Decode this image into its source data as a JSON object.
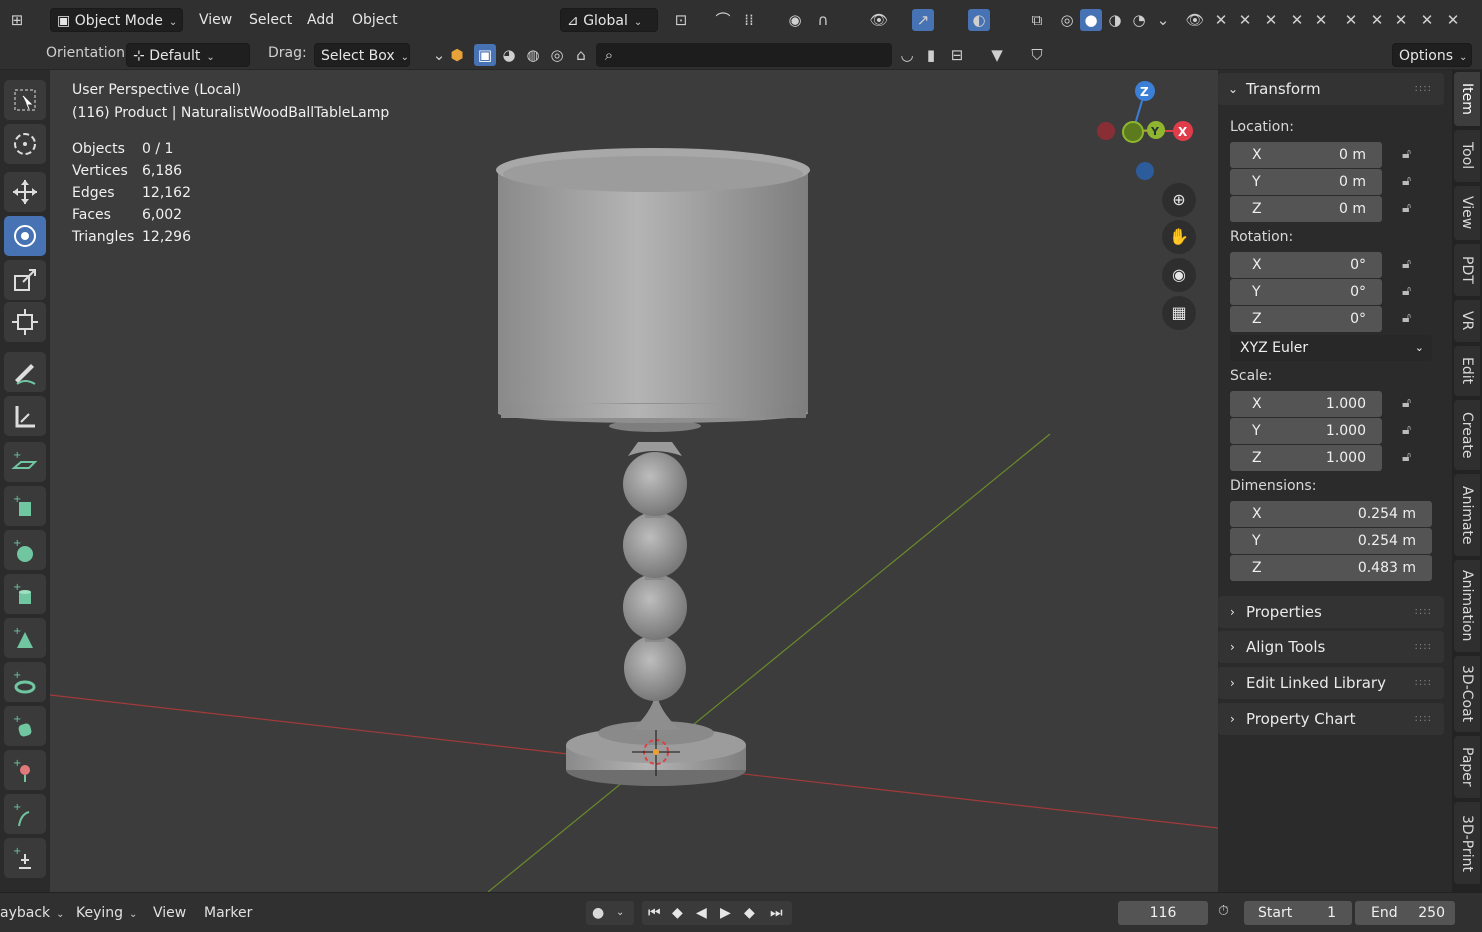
{
  "header": {
    "mode": "Object Mode",
    "menus": [
      "View",
      "Select",
      "Add",
      "Object"
    ],
    "transform_orientation": "Global",
    "orientation_label": "Orientation:",
    "orientation_value": "Default",
    "drag_label": "Drag:",
    "drag_value": "Select Box",
    "options": "Options"
  },
  "viewport": {
    "view_name": "User Perspective (Local)",
    "object_line": "(116) Product | NaturalistWoodBallTableLamp",
    "stats": [
      {
        "label": "Objects",
        "value": "0 / 1"
      },
      {
        "label": "Vertices",
        "value": "6,186"
      },
      {
        "label": "Edges",
        "value": "12,162"
      },
      {
        "label": "Faces",
        "value": "6,002"
      },
      {
        "label": "Triangles",
        "value": "12,296"
      }
    ],
    "gizmo": {
      "x": "X",
      "y": "Y",
      "z": "Z"
    },
    "colors": {
      "x_axis": "#e03c4a",
      "y_axis": "#8fb62e",
      "z_axis": "#3b7fd6",
      "floor_x": "#a33a3a",
      "floor_y": "#6a8a2a"
    }
  },
  "npanel": {
    "transform": {
      "title": "Transform",
      "location_label": "Location:",
      "location": [
        {
          "axis": "X",
          "value": "0 m"
        },
        {
          "axis": "Y",
          "value": "0 m"
        },
        {
          "axis": "Z",
          "value": "0 m"
        }
      ],
      "rotation_label": "Rotation:",
      "rotation": [
        {
          "axis": "X",
          "value": "0°"
        },
        {
          "axis": "Y",
          "value": "0°"
        },
        {
          "axis": "Z",
          "value": "0°"
        }
      ],
      "rotation_mode": "XYZ Euler",
      "scale_label": "Scale:",
      "scale": [
        {
          "axis": "X",
          "value": "1.000"
        },
        {
          "axis": "Y",
          "value": "1.000"
        },
        {
          "axis": "Z",
          "value": "1.000"
        }
      ],
      "dimensions_label": "Dimensions:",
      "dimensions": [
        {
          "axis": "X",
          "value": "0.254 m"
        },
        {
          "axis": "Y",
          "value": "0.254 m"
        },
        {
          "axis": "Z",
          "value": "0.483 m"
        }
      ]
    },
    "collapsed_panels": [
      "Properties",
      "Align Tools",
      "Edit Linked Library",
      "Property Chart"
    ]
  },
  "tabs": [
    "Item",
    "Tool",
    "View",
    "PDT",
    "VR",
    "Edit",
    "Create",
    "Animate",
    "Animation",
    "3D-Coat",
    "Paper",
    "3D-Print"
  ],
  "timeline": {
    "playback": "ayback",
    "keying": "Keying",
    "view": "View",
    "marker": "Marker",
    "current_frame": "116",
    "start_label": "Start",
    "start_value": "1",
    "end_label": "End",
    "end_value": "250"
  },
  "accent": "#4772b3"
}
